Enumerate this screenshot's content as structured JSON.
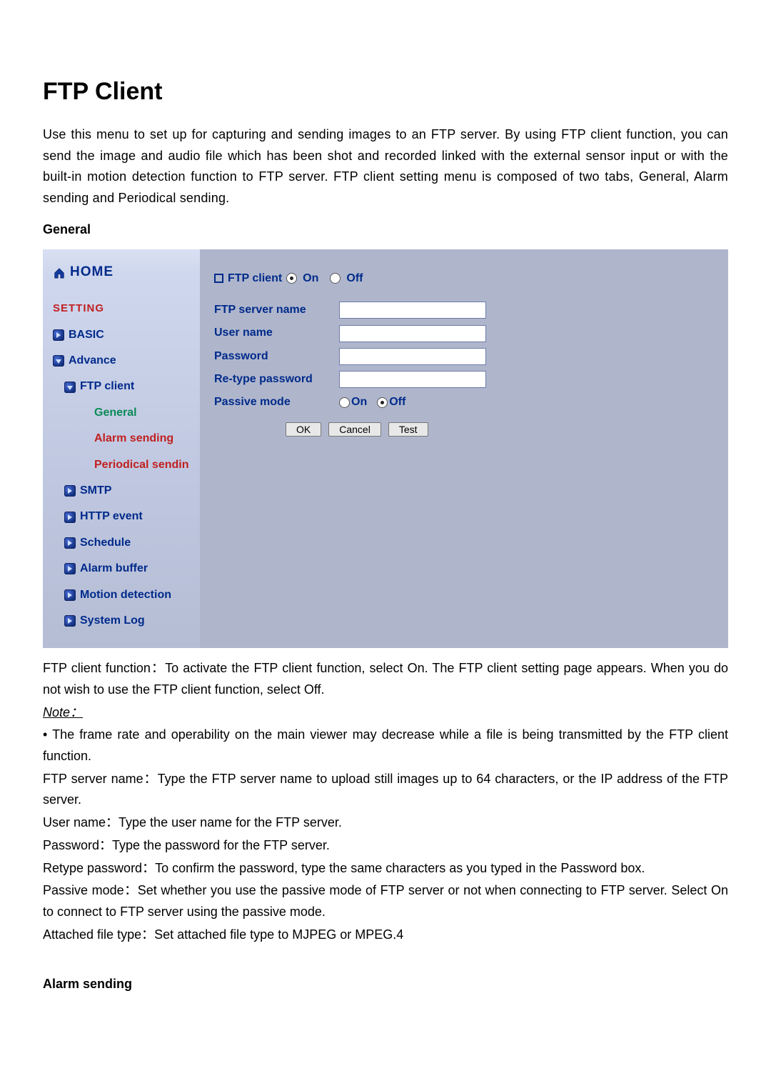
{
  "title": "FTP Client",
  "intro": "Use this menu to set up for capturing and sending images to an FTP server. By using FTP client function, you can send the image and audio file which has been shot and recorded linked with the external sensor input or with the built-in motion detection function to FTP server. FTP client setting menu is composed of two tabs, General, Alarm sending and Periodical sending.",
  "general_label": "General",
  "sidebar": {
    "home": "HOME",
    "setting": "SETTING",
    "basic": "BASIC",
    "advance": "Advance",
    "ftp_client": "FTP client",
    "general": "General",
    "alarm_sending": "Alarm sending",
    "periodical_sending": "Periodical sendin",
    "smtp": "SMTP",
    "http_event": "HTTP event",
    "schedule": "Schedule",
    "alarm_buffer": "Alarm buffer",
    "motion_detection": "Motion detection",
    "system_log": "System Log"
  },
  "form": {
    "header_label": "FTP client",
    "on_label": "On",
    "off_label": "Off",
    "ftp_server_name": "FTP server name",
    "user_name": "User name",
    "password": "Password",
    "retype_password": "Re-type password",
    "passive_mode": "Passive mode",
    "passive_on": "On",
    "passive_off": "Off",
    "ok": "OK",
    "cancel": "Cancel",
    "test": "Test",
    "values": {
      "ftp_server_name": "",
      "user_name": "",
      "password": "",
      "retype_password": ""
    },
    "ftp_client_selected": "On",
    "passive_mode_selected": "Off"
  },
  "post": {
    "p1": "FTP client function：To activate the FTP client function, select On. The FTP client setting page appears. When you do not wish to use the FTP client function, select Off.",
    "note_hdr": "Note：",
    "note_body": "• The frame rate and operability on the main viewer may decrease while a file is being transmitted by the FTP client function.",
    "p2": "FTP server name：Type the FTP server name to upload still images up to 64 characters, or the IP address of the FTP server.",
    "p3": "User name：Type the user name for the FTP server.",
    "p4": "Password：Type the password for the FTP server.",
    "p5": "Retype password：To confirm the password, type the same characters as you typed in the Password box.",
    "p6": "Passive mode：Set whether you use the passive mode of FTP server or not when connecting to FTP server. Select On to connect to FTP server using the passive mode.",
    "p7": "Attached file type：Set attached file type to MJPEG or MPEG.4"
  },
  "alarm_sending_hdr": "Alarm sending"
}
